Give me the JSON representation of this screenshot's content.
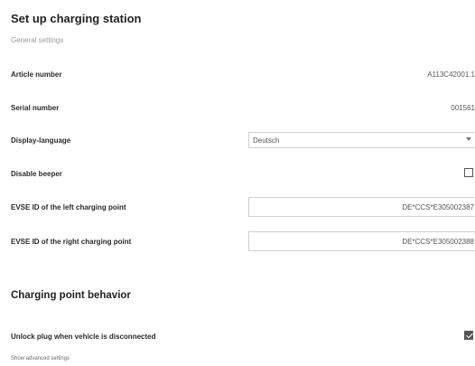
{
  "header": {
    "title": "Set up charging station",
    "subtitle": "General settings"
  },
  "general": {
    "article_number": {
      "label": "Article number",
      "value": "A113C42001.1"
    },
    "serial_number": {
      "label": "Serial number",
      "value": "001561"
    },
    "display_language": {
      "label": "Display-language",
      "selected": "Deutsch"
    },
    "disable_beeper": {
      "label": "Disable beeper",
      "checked": false
    },
    "evse_left": {
      "label": "EVSE ID of the left charging point",
      "value": "DE*CCS*E305002387"
    },
    "evse_right": {
      "label": "EVSE ID of the right charging point",
      "value": "DE*CCS*E305002388"
    }
  },
  "behavior": {
    "title": "Charging point behavior",
    "unlock_plug": {
      "label": "Unlock plug when vehicle is disconnected",
      "checked": true
    },
    "advanced_link": "Show advanced settings"
  }
}
